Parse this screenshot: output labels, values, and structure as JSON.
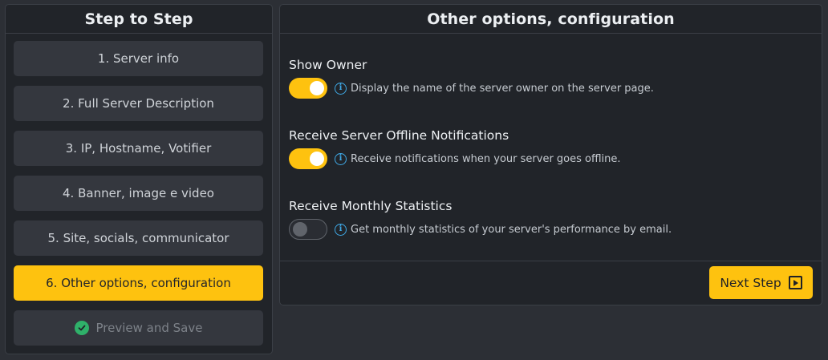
{
  "sidebar": {
    "title": "Step to Step",
    "steps": [
      {
        "label": "1. Server info"
      },
      {
        "label": "2. Full Server Description"
      },
      {
        "label": "3. IP, Hostname, Votifier"
      },
      {
        "label": "4. Banner, image e video"
      },
      {
        "label": "5. Site, socials, communicator"
      },
      {
        "label": "6. Other options, configuration",
        "state": "active"
      },
      {
        "label": "Preview and Save",
        "state": "disabled",
        "icon": "check-circle-icon"
      }
    ]
  },
  "main": {
    "title": "Other options, configuration",
    "options": [
      {
        "title": "Show Owner",
        "description": "Display the name of the server owner on the server page.",
        "enabled": true
      },
      {
        "title": "Receive Server Offline Notifications",
        "description": "Receive notifications when your server goes offline.",
        "enabled": true
      },
      {
        "title": "Receive Monthly Statistics",
        "description": "Get monthly statistics of your server's performance by email.",
        "enabled": false
      }
    ],
    "info_icon_glyph": "i",
    "next_button": {
      "label": "Next Step",
      "icon": "play-square-icon"
    }
  },
  "colors": {
    "accent": "#fec20f",
    "background": "#2c2f35",
    "panel": "#212429",
    "step": "#34373e",
    "info": "#3fa9e6",
    "success": "#2fb16a"
  }
}
